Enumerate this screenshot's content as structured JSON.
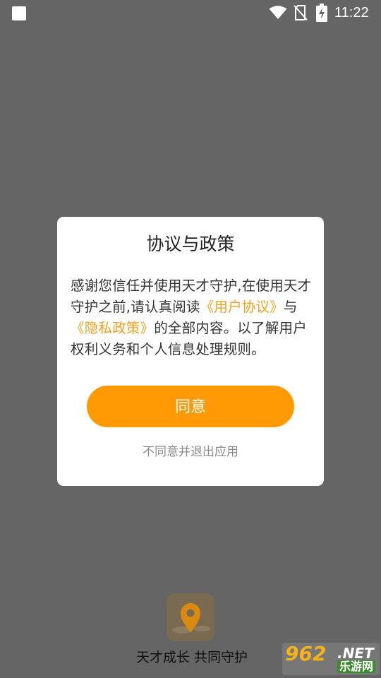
{
  "status_bar": {
    "time": "11:22",
    "icons": [
      "notification-icon",
      "wifi-icon",
      "no-sim-icon",
      "battery-charging-icon"
    ]
  },
  "dialog": {
    "title": "协议与政策",
    "body_prefix": "感谢您信任并使用天才守护,在使用天才守护之前,请认真阅读",
    "user_agreement_link": "《用户协议》",
    "body_and": "与",
    "privacy_policy_link": "《隐私政策》",
    "body_suffix": "的全部内容。以了解用户权利义务和个人信息处理规则。",
    "agree_button": "同意",
    "disagree_link": "不同意并退出应用"
  },
  "splash": {
    "logo_icon": "location-pin-icon",
    "slogan": "天才成长 共同守护"
  },
  "watermark": {
    "number": "962",
    "suffix": ".NET",
    "site_name": "乐游网"
  },
  "colors": {
    "background": "#656565",
    "accent": "#ff9a05",
    "link": "#f0a020"
  }
}
